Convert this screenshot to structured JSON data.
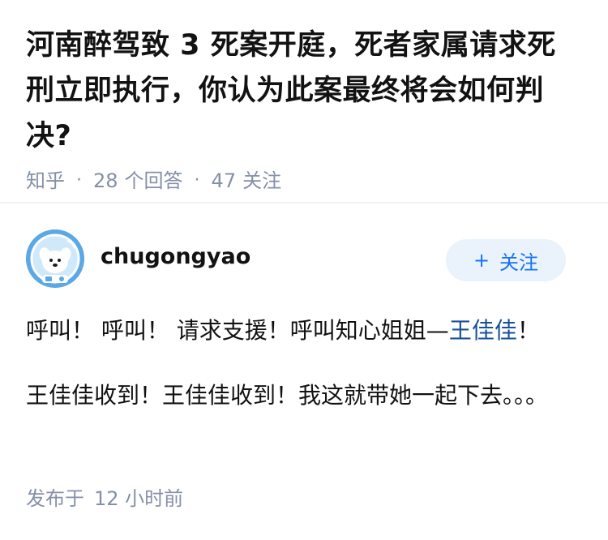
{
  "question": {
    "title": "河南醉驾致 3 死案开庭，死者家属请求死刑立即执行，你认为此案最终将会如何判决?",
    "source": "知乎",
    "answer_count": "28",
    "answer_label": "个回答",
    "follower_count": "47",
    "follower_label": "关注",
    "separator": "·"
  },
  "author": {
    "name": "chugongyao",
    "follow_icon": "+",
    "follow_label": "关注",
    "avatar_icon": "astronaut-dog-avatar"
  },
  "answer": {
    "p1_text": "呼叫！ 呼叫！ 请求支援！呼叫知心姐姐—",
    "p1_link": "王佳佳",
    "p1_end": "！",
    "p2_text": "王佳佳收到！王佳佳收到！我这就带她一起下去。。。"
  },
  "footer": {
    "published_label": "发布于",
    "published_time": "12 小时前"
  },
  "colors": {
    "meta": "#8590a6",
    "link": "#175199",
    "follow_text": "#1772f6",
    "follow_bg": "#eaf2fb"
  }
}
